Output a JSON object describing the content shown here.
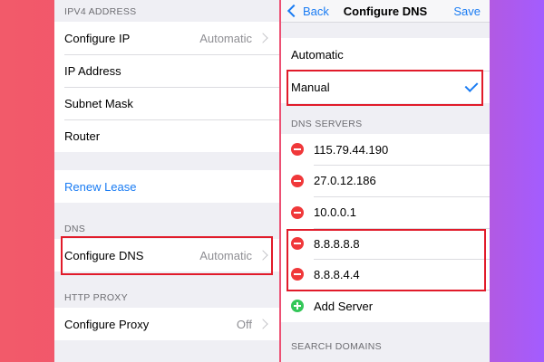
{
  "left_panel": {
    "ipv4_header": "IPV4 ADDRESS",
    "ipv4_rows": [
      {
        "label": "Configure IP",
        "value": "Automatic"
      },
      {
        "label": "IP Address"
      },
      {
        "label": "Subnet Mask"
      },
      {
        "label": "Router"
      }
    ],
    "renew_lease": "Renew Lease",
    "dns_header": "DNS",
    "configure_dns": {
      "label": "Configure DNS",
      "value": "Automatic"
    },
    "http_proxy_header": "HTTP PROXY",
    "configure_proxy": {
      "label": "Configure Proxy",
      "value": "Off"
    }
  },
  "right_panel": {
    "nav": {
      "back": "Back",
      "title": "Configure DNS",
      "save": "Save"
    },
    "mode_options": [
      {
        "label": "Automatic",
        "selected": false
      },
      {
        "label": "Manual",
        "selected": true
      }
    ],
    "dns_servers_header": "DNS SERVERS",
    "dns_servers": [
      "115.79.44.190",
      "27.0.12.186",
      "10.0.0.1",
      "8.8.8.8.8",
      "8.8.8.4.4"
    ],
    "add_server": "Add Server",
    "search_domains_header": "SEARCH DOMAINS"
  },
  "colors": {
    "accent": "#1a7cf3",
    "delete": "#f0383a",
    "add": "#34c759",
    "highlight": "#e11b2a"
  }
}
